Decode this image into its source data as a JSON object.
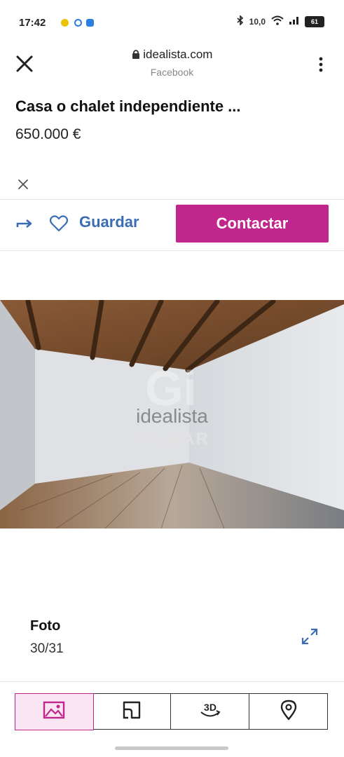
{
  "status_bar": {
    "time": "17:42",
    "network_speed": "10,0",
    "battery": "61"
  },
  "browser": {
    "url": "idealista.com",
    "source": "Facebook"
  },
  "listing": {
    "title": "Casa o chalet independiente ...",
    "price": "650.000 €"
  },
  "actions": {
    "save_label": "Guardar",
    "contact_label": "Contactar",
    "accent_color": "#c0268b",
    "link_color": "#3b6db4"
  },
  "photo": {
    "watermark_brand": "idealista",
    "watermark_agency": "GILMAR"
  },
  "gallery": {
    "label": "Foto",
    "counter": "30/31"
  },
  "tabs": [
    {
      "name": "photos",
      "icon": "image-icon",
      "active": true
    },
    {
      "name": "plan",
      "icon": "floorplan-icon",
      "active": false
    },
    {
      "name": "3d",
      "icon": "3d-tour-icon",
      "active": false
    },
    {
      "name": "map",
      "icon": "location-pin-icon",
      "active": false
    }
  ]
}
